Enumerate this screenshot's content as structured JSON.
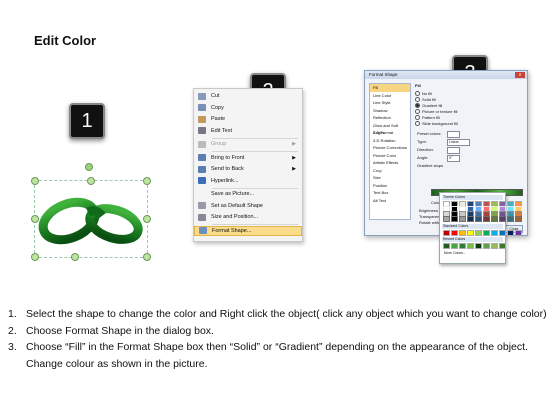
{
  "title": "Edit Color",
  "badges": [
    "1",
    "2",
    "3"
  ],
  "context_menu": {
    "items": [
      {
        "label": "Cut",
        "icon": "scissors-icon",
        "color": "#8899bb",
        "arrow": false,
        "disabled": false
      },
      {
        "label": "Copy",
        "icon": "copy-icon",
        "color": "#7b8fb6",
        "arrow": false,
        "disabled": false
      },
      {
        "label": "Paste",
        "icon": "paste-icon",
        "color": "#c49a5a",
        "arrow": false,
        "disabled": false
      },
      {
        "label": "Edit Text",
        "icon": "edit-text-icon",
        "color": "#778",
        "arrow": false,
        "disabled": false
      },
      {
        "label": "Group",
        "icon": "group-icon",
        "color": "#bbb",
        "arrow": true,
        "disabled": true
      },
      {
        "label": "Bring to Front",
        "icon": "bring-front-icon",
        "color": "#5b7fb0",
        "arrow": true,
        "disabled": false
      },
      {
        "label": "Send to Back",
        "icon": "send-back-icon",
        "color": "#5b7fb0",
        "arrow": true,
        "disabled": false
      },
      {
        "label": "Hyperlink...",
        "icon": "hyperlink-icon",
        "color": "#3a6fb8",
        "arrow": false,
        "disabled": false
      },
      {
        "label": "Save as Picture...",
        "icon": "",
        "color": "",
        "arrow": false,
        "disabled": false
      },
      {
        "label": "Set as Default Shape",
        "icon": "default-shape-icon",
        "color": "#99a",
        "arrow": false,
        "disabled": false
      },
      {
        "label": "Size and Position...",
        "icon": "size-position-icon",
        "color": "#889",
        "arrow": false,
        "disabled": false
      },
      {
        "label": "Format Shape...",
        "icon": "format-shape-icon",
        "color": "#6a8fc0",
        "arrow": false,
        "disabled": false,
        "highlighted": true
      }
    ]
  },
  "dialog": {
    "title": "Format Shape",
    "nav": [
      "Fill",
      "Line Color",
      "Line Style",
      "Shadow",
      "Reflection",
      "Glow and Soft Edges",
      "3-D Format",
      "3-D Rotation",
      "Picture Corrections",
      "Picture Color",
      "Artistic Effects",
      "Crop",
      "Size",
      "Position",
      "Text Box",
      "Alt Text"
    ],
    "section": "Fill",
    "fill_options": [
      "No fill",
      "Solid fill",
      "Gradient fill",
      "Picture or texture fill",
      "Pattern fill",
      "Slide background fill"
    ],
    "selected_fill": "Gradient fill",
    "fields": [
      {
        "label": "Preset colors:"
      },
      {
        "label": "Type:",
        "value": "Linear"
      },
      {
        "label": "Direction:"
      },
      {
        "label": "Angle:",
        "value": "0°"
      },
      {
        "label": "Gradient stops"
      }
    ],
    "lower_labels": [
      "Color",
      "Position:",
      "Brightness",
      "Transparency",
      "Rotate with shape"
    ],
    "position_value": "25%",
    "buttons": [
      "Close"
    ],
    "popup": {
      "theme_header": "Theme Colors",
      "standard_header": "Standard Colors",
      "recent_header": "Recent Colors",
      "more": "More Colors...",
      "theme_colors": [
        "#ffffff",
        "#000000",
        "#eeece1",
        "#1f497d",
        "#4f81bd",
        "#c0504d",
        "#9bbb59",
        "#8064a2",
        "#4bacc6",
        "#f79646"
      ],
      "standard_colors": [
        "#c00000",
        "#ff0000",
        "#ffc000",
        "#ffff00",
        "#92d050",
        "#00b050",
        "#00b0f0",
        "#0070c0",
        "#002060",
        "#7030a0"
      ],
      "recent_colors": [
        "#1f5e1f",
        "#49a63a",
        "#2e7d32",
        "#76c043",
        "#0b3d0b",
        "#5fa04e",
        "#9bbb59",
        "#3b7a2a"
      ]
    }
  },
  "steps": [
    {
      "num": "1.",
      "text": "Select the shape to change the color and Right click the object( click any object which you want to change color)"
    },
    {
      "num": "2.",
      "text": "Choose Format Shape in the dialog box."
    },
    {
      "num": "3.",
      "text": "Choose “Fill” in the Format Shape box then “Solid” or “Gradient” depending on the appearance of the object. Change colour as shown in the picture."
    }
  ],
  "colors": {
    "chain_dark": "#0f6a1a",
    "chain_light": "#3fb23b",
    "highlight": "#fbdc8b"
  }
}
